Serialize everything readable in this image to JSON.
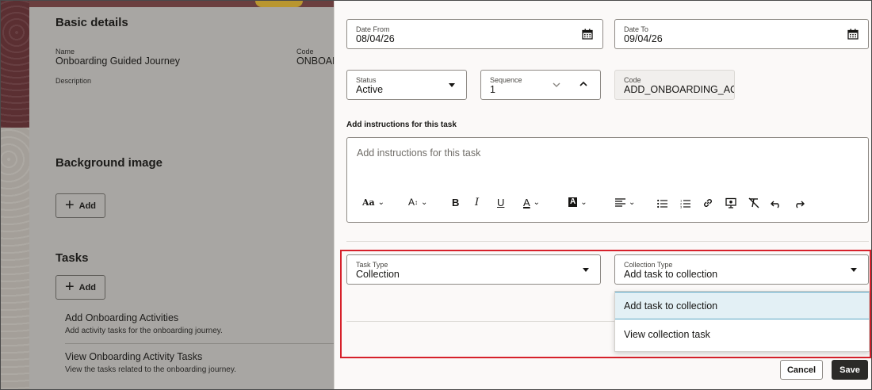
{
  "background": {
    "basic_details_title": "Basic details",
    "name_label": "Name",
    "name_value": "Onboarding Guided Journey",
    "code_label": "Code",
    "code_value": "ONBOAR",
    "description_label": "Description",
    "background_image_title": "Background image",
    "add_label": "Add",
    "tasks_title": "Tasks",
    "tasks_add_label": "Add",
    "tasks": [
      {
        "title": "Add Onboarding Activities",
        "subtitle": "Add activity tasks for the onboarding journey."
      },
      {
        "title": "View Onboarding Activity Tasks",
        "subtitle": "View the tasks related to the onboarding journey."
      }
    ]
  },
  "drawer": {
    "date_from": {
      "label": "Date From",
      "value": "08/04/26"
    },
    "date_to": {
      "label": "Date To",
      "value": "09/04/26"
    },
    "status": {
      "label": "Status",
      "value": "Active"
    },
    "sequence": {
      "label": "Sequence",
      "value": "1"
    },
    "code": {
      "label": "Code",
      "value": "ADD_ONBOARDING_ACT"
    },
    "instructions_label": "Add instructions for this task",
    "instructions_placeholder": "Add instructions for this task",
    "toolbar": {
      "font": "Aa",
      "size": "A",
      "bold": "B",
      "italic": "I",
      "underline": "U",
      "font_color": "A",
      "bg_color": "A"
    },
    "task_type": {
      "label": "Task Type",
      "value": "Collection"
    },
    "collection_type": {
      "label": "Collection Type",
      "value": "Add task to collection",
      "options": [
        "Add task to collection",
        "View collection task"
      ]
    },
    "cancel_label": "Cancel",
    "save_label": "Save"
  },
  "colors": {
    "highlight": "#d6212b",
    "selected_option": "#e3f0f5",
    "save_button": "#2b2a28"
  }
}
